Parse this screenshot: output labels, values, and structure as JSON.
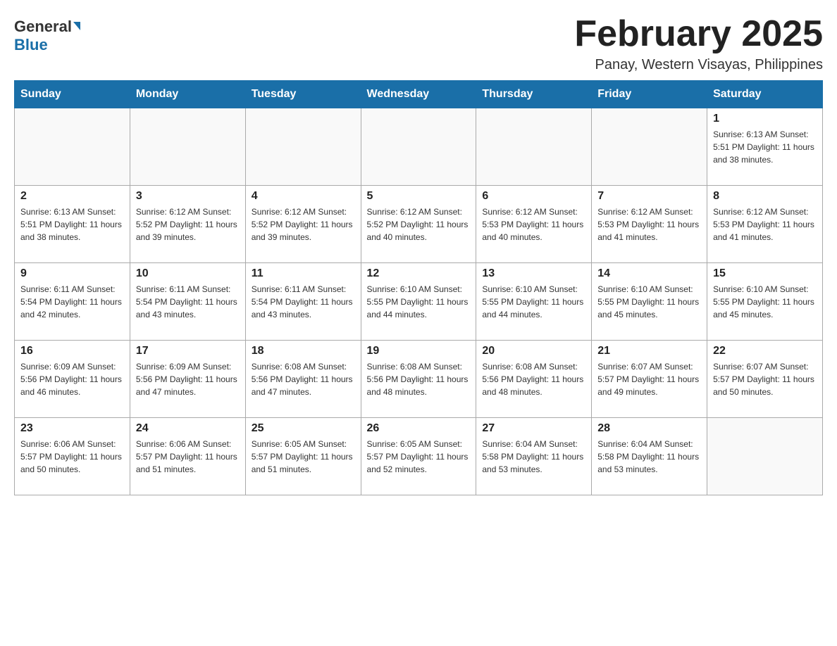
{
  "header": {
    "logo_general": "General",
    "logo_blue": "Blue",
    "month_title": "February 2025",
    "location": "Panay, Western Visayas, Philippines"
  },
  "weekdays": [
    "Sunday",
    "Monday",
    "Tuesday",
    "Wednesday",
    "Thursday",
    "Friday",
    "Saturday"
  ],
  "weeks": [
    [
      {
        "day": "",
        "info": ""
      },
      {
        "day": "",
        "info": ""
      },
      {
        "day": "",
        "info": ""
      },
      {
        "day": "",
        "info": ""
      },
      {
        "day": "",
        "info": ""
      },
      {
        "day": "",
        "info": ""
      },
      {
        "day": "1",
        "info": "Sunrise: 6:13 AM\nSunset: 5:51 PM\nDaylight: 11 hours and 38 minutes."
      }
    ],
    [
      {
        "day": "2",
        "info": "Sunrise: 6:13 AM\nSunset: 5:51 PM\nDaylight: 11 hours and 38 minutes."
      },
      {
        "day": "3",
        "info": "Sunrise: 6:12 AM\nSunset: 5:52 PM\nDaylight: 11 hours and 39 minutes."
      },
      {
        "day": "4",
        "info": "Sunrise: 6:12 AM\nSunset: 5:52 PM\nDaylight: 11 hours and 39 minutes."
      },
      {
        "day": "5",
        "info": "Sunrise: 6:12 AM\nSunset: 5:52 PM\nDaylight: 11 hours and 40 minutes."
      },
      {
        "day": "6",
        "info": "Sunrise: 6:12 AM\nSunset: 5:53 PM\nDaylight: 11 hours and 40 minutes."
      },
      {
        "day": "7",
        "info": "Sunrise: 6:12 AM\nSunset: 5:53 PM\nDaylight: 11 hours and 41 minutes."
      },
      {
        "day": "8",
        "info": "Sunrise: 6:12 AM\nSunset: 5:53 PM\nDaylight: 11 hours and 41 minutes."
      }
    ],
    [
      {
        "day": "9",
        "info": "Sunrise: 6:11 AM\nSunset: 5:54 PM\nDaylight: 11 hours and 42 minutes."
      },
      {
        "day": "10",
        "info": "Sunrise: 6:11 AM\nSunset: 5:54 PM\nDaylight: 11 hours and 43 minutes."
      },
      {
        "day": "11",
        "info": "Sunrise: 6:11 AM\nSunset: 5:54 PM\nDaylight: 11 hours and 43 minutes."
      },
      {
        "day": "12",
        "info": "Sunrise: 6:10 AM\nSunset: 5:55 PM\nDaylight: 11 hours and 44 minutes."
      },
      {
        "day": "13",
        "info": "Sunrise: 6:10 AM\nSunset: 5:55 PM\nDaylight: 11 hours and 44 minutes."
      },
      {
        "day": "14",
        "info": "Sunrise: 6:10 AM\nSunset: 5:55 PM\nDaylight: 11 hours and 45 minutes."
      },
      {
        "day": "15",
        "info": "Sunrise: 6:10 AM\nSunset: 5:55 PM\nDaylight: 11 hours and 45 minutes."
      }
    ],
    [
      {
        "day": "16",
        "info": "Sunrise: 6:09 AM\nSunset: 5:56 PM\nDaylight: 11 hours and 46 minutes."
      },
      {
        "day": "17",
        "info": "Sunrise: 6:09 AM\nSunset: 5:56 PM\nDaylight: 11 hours and 47 minutes."
      },
      {
        "day": "18",
        "info": "Sunrise: 6:08 AM\nSunset: 5:56 PM\nDaylight: 11 hours and 47 minutes."
      },
      {
        "day": "19",
        "info": "Sunrise: 6:08 AM\nSunset: 5:56 PM\nDaylight: 11 hours and 48 minutes."
      },
      {
        "day": "20",
        "info": "Sunrise: 6:08 AM\nSunset: 5:56 PM\nDaylight: 11 hours and 48 minutes."
      },
      {
        "day": "21",
        "info": "Sunrise: 6:07 AM\nSunset: 5:57 PM\nDaylight: 11 hours and 49 minutes."
      },
      {
        "day": "22",
        "info": "Sunrise: 6:07 AM\nSunset: 5:57 PM\nDaylight: 11 hours and 50 minutes."
      }
    ],
    [
      {
        "day": "23",
        "info": "Sunrise: 6:06 AM\nSunset: 5:57 PM\nDaylight: 11 hours and 50 minutes."
      },
      {
        "day": "24",
        "info": "Sunrise: 6:06 AM\nSunset: 5:57 PM\nDaylight: 11 hours and 51 minutes."
      },
      {
        "day": "25",
        "info": "Sunrise: 6:05 AM\nSunset: 5:57 PM\nDaylight: 11 hours and 51 minutes."
      },
      {
        "day": "26",
        "info": "Sunrise: 6:05 AM\nSunset: 5:57 PM\nDaylight: 11 hours and 52 minutes."
      },
      {
        "day": "27",
        "info": "Sunrise: 6:04 AM\nSunset: 5:58 PM\nDaylight: 11 hours and 53 minutes."
      },
      {
        "day": "28",
        "info": "Sunrise: 6:04 AM\nSunset: 5:58 PM\nDaylight: 11 hours and 53 minutes."
      },
      {
        "day": "",
        "info": ""
      }
    ]
  ]
}
